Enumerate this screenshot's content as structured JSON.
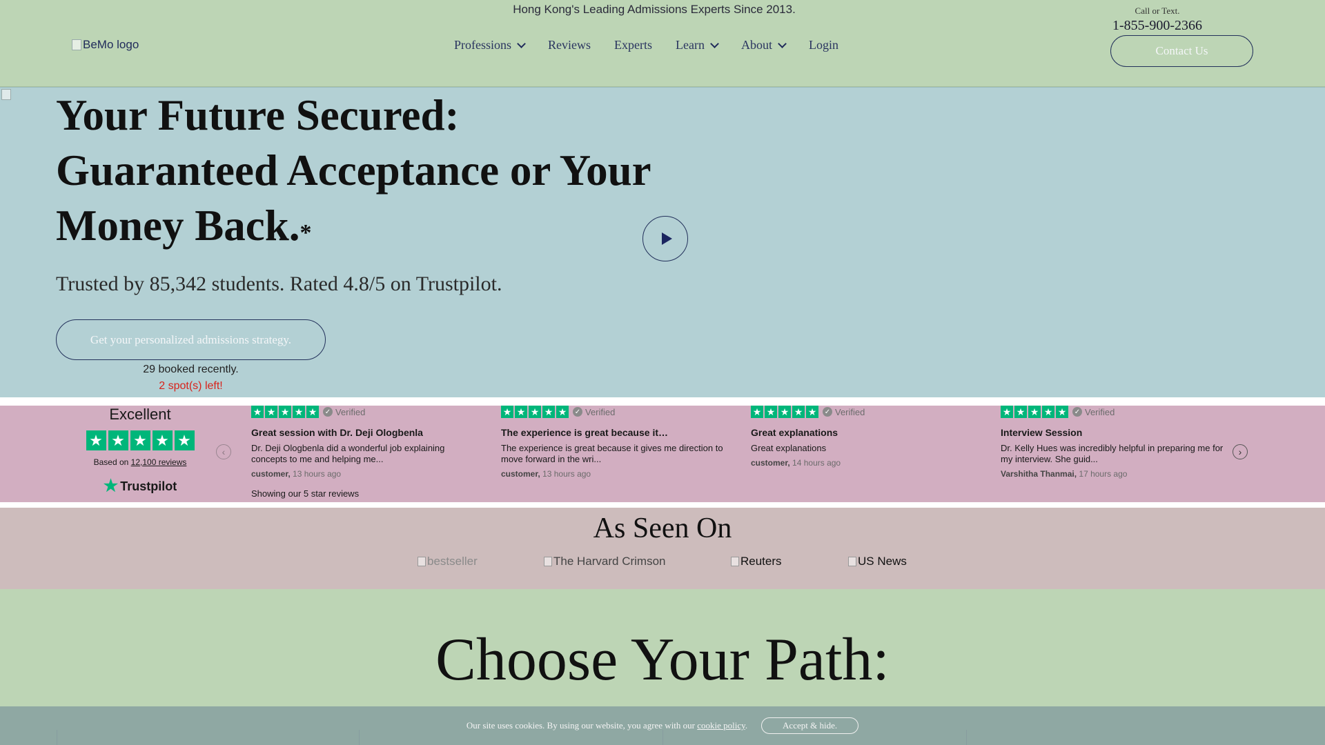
{
  "header": {
    "tagline": "Hong Kong's Leading Admissions Experts Since 2013.",
    "logo_alt": "BeMo logo",
    "nav": [
      {
        "label": "Professions",
        "dropdown": true
      },
      {
        "label": "Reviews",
        "dropdown": false
      },
      {
        "label": "Experts",
        "dropdown": false
      },
      {
        "label": "Learn",
        "dropdown": true
      },
      {
        "label": "About",
        "dropdown": true
      },
      {
        "label": "Login",
        "dropdown": false
      }
    ],
    "call_label": "Call or Text.",
    "phone": "1-855-900-2366",
    "contact_label": "Contact Us"
  },
  "hero": {
    "title": "Your Future Secured: Guaranteed Acceptance or Your Money Back.",
    "asterisk": "*",
    "subtitle": "Trusted by 85,342 students. Rated 4.8/5 on Trustpilot.",
    "cta_label": "Get your personalized admissions strategy.",
    "booked": "29 booked recently.",
    "spots": "2 spot(s) left!"
  },
  "trustpilot": {
    "rating_word": "Excellent",
    "based_prefix": "Based on",
    "reviews_count": "12,100 reviews",
    "brand": "Trustpilot",
    "showing": "Showing our 5 star reviews",
    "verified_label": "Verified",
    "reviews": [
      {
        "title": "Great session with Dr. Deji Ologbenla",
        "body": "Dr. Deji Ologbenla did a wonderful job explaining concepts to me and helping me...",
        "author": "customer,",
        "time": "13 hours ago"
      },
      {
        "title": "The experience is great because it…",
        "body": "The experience is great because it gives me direction to move forward in the wri...",
        "author": "customer,",
        "time": "13 hours ago"
      },
      {
        "title": "Great explanations",
        "body": "Great explanations",
        "author": "customer,",
        "time": "14 hours ago"
      },
      {
        "title": "Interview Session",
        "body": "Dr. Kelly Hues was incredibly helpful in preparing me for my interview. She guid...",
        "author": "Varshitha Thanmai,",
        "time": "17 hours ago"
      }
    ]
  },
  "seen_on": {
    "title": "As Seen On",
    "logos": [
      "bestseller",
      "The Harvard Crimson",
      "Reuters",
      "US News"
    ]
  },
  "choose": {
    "title": "Choose Your Path:"
  },
  "cookie": {
    "text": "Our site uses cookies. By using our website, you agree with our",
    "link": "cookie policy",
    "period": ".",
    "accept": "Accept & hide."
  }
}
